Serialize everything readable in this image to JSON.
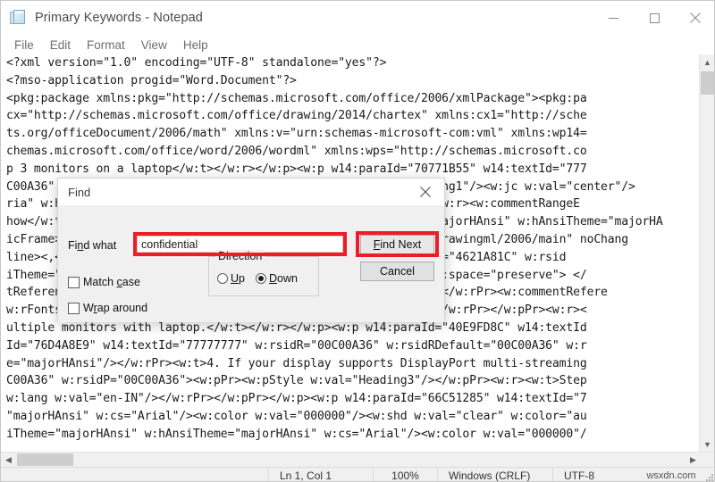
{
  "window": {
    "title": "Primary Keywords - Notepad",
    "icon": "notepad-icon",
    "minimize_label": "Minimize",
    "maximize_label": "Maximize",
    "close_label": "Close"
  },
  "menu": {
    "items": [
      {
        "label": "File"
      },
      {
        "label": "Edit"
      },
      {
        "label": "Format"
      },
      {
        "label": "View"
      },
      {
        "label": "Help"
      }
    ]
  },
  "editor": {
    "lines": [
      "<?xml version=\"1.0\" encoding=\"UTF-8\" standalone=\"yes\"?>",
      "<?mso-application progid=\"Word.Document\"?>",
      "<pkg:package xmlns:pkg=\"http://schemas.microsoft.com/office/2006/xmlPackage\"><pkg:pa",
      "cx=\"http://schemas.microsoft.com/office/drawing/2014/chartex\" xmlns:cx1=\"http://sche",
      "ts.org/officeDocument/2006/math\" xmlns:v=\"urn:schemas-microsoft-com:vml\" xmlns:wp14=",
      "chemas.microsoft.com/office/word/2006/wordml\" xmlns:wps=\"http://schemas.microsoft.co",
      "p 3 monitors on a laptop</w:t></w:r></w:p><w:p w14:paraId=\"70771B55\" w14:textId=\"777",
      "C00A36\" w:rsidRDefault=\"00C00A36\"><w:pPr><w:pStyle w:val=\"Heading1\"/><w:jc w:val=\"center\"/>",
      "ria\" w:hAnsi=\"Cambria\"/><w:sz w:val=\"28\"/></w:rPr><w:id=\"2\"/></w:r><w:commentRangeE",
      "how</w:t></w:r></w:p><w:p w14:paraId=\"1A2B3C4D\" w:asciiTheme=\"majorHAnsi\" w:hAnsiTheme=\"majorHA",
      "icFrame><a:graphic xmlns:a=\"http://schemas.openxmlformats.org/drawingml/2006/main\" noChang",
      "line><,<w:rPr><w:rFonts w:asciiTheme=\"majorHAnsi\"/>\" w14:textId=\"4621A81C\" w:rsid",
      "iTheme=\"majorHAnsi\" w:hAnsiTheme=\"majorHAnsi\"/></w:rPr><w:t xml:space=\"preserve\"> </",
      "tReference w:id=\"3\"/></w:r><w:rPr><w:rFonts w:ascii=\"Cambria\"/></w:rPr><w:commentRefere",
      "w:rFonts w:asciiTheme=\"majorHAnsi\" w:hAnsiTheme=\"majorHAnsi\"/></w:rPr></w:pPr><w:r><",
      "ultiple monitors with laptop.</w:t></w:r></w:p><w:p w14:paraId=\"40E9FD8C\" w14:textId",
      "Id=\"76D4A8E9\" w14:textId=\"77777777\" w:rsidR=\"00C00A36\" w:rsidRDefault=\"00C00A36\" w:r",
      "e=\"majorHAnsi\"/></w:rPr><w:t>4. If your display supports DisplayPort multi-streaming",
      "C00A36\" w:rsidP=\"00C00A36\"><w:pPr><w:pStyle w:val=\"Heading3\"/></w:pPr><w:r><w:t>Step",
      "w:lang w:val=\"en-IN\"/></w:rPr></w:pPr></w:p><w:p w14:paraId=\"66C51285\" w14:textId=\"7",
      "\"majorHAnsi\" w:cs=\"Arial\"/><w:color w:val=\"000000\"/><w:shd w:val=\"clear\" w:color=\"au",
      "iTheme=\"majorHAnsi\" w:hAnsiTheme=\"majorHAnsi\" w:cs=\"Arial\"/><w:color w:val=\"000000\"/"
    ]
  },
  "scrollbars": {
    "up_arrow": "scroll-up-icon",
    "down_arrow": "scroll-down-icon",
    "left_arrow": "scroll-left-icon",
    "right_arrow": "scroll-right-icon"
  },
  "find_dialog": {
    "title": "Find",
    "close_label": "Close",
    "find_what_label_pre": "Fi",
    "find_what_label_accel": "n",
    "find_what_label_post": "d what",
    "find_what_value": "confidential",
    "find_next_accel": "F",
    "find_next_rest": "ind Next",
    "cancel_label": "Cancel",
    "direction_legend": "Direction",
    "direction_up_accel": "U",
    "direction_up_rest": "p",
    "direction_down_accel": "D",
    "direction_down_rest": "own",
    "direction_selected": "Down",
    "match_case_pre": "Match ",
    "match_case_accel": "c",
    "match_case_post": "ase",
    "match_case_checked": false,
    "wrap_around_pre": "W",
    "wrap_around_accel": "r",
    "wrap_around_post": "ap around",
    "wrap_around_checked": false,
    "highlight_color": "#ee1c25"
  },
  "statusbar": {
    "position": "Ln 1, Col 1",
    "zoom": "100%",
    "line_ending": "Windows (CRLF)",
    "encoding": "UTF-8",
    "watermark": "wsxdn.com"
  }
}
